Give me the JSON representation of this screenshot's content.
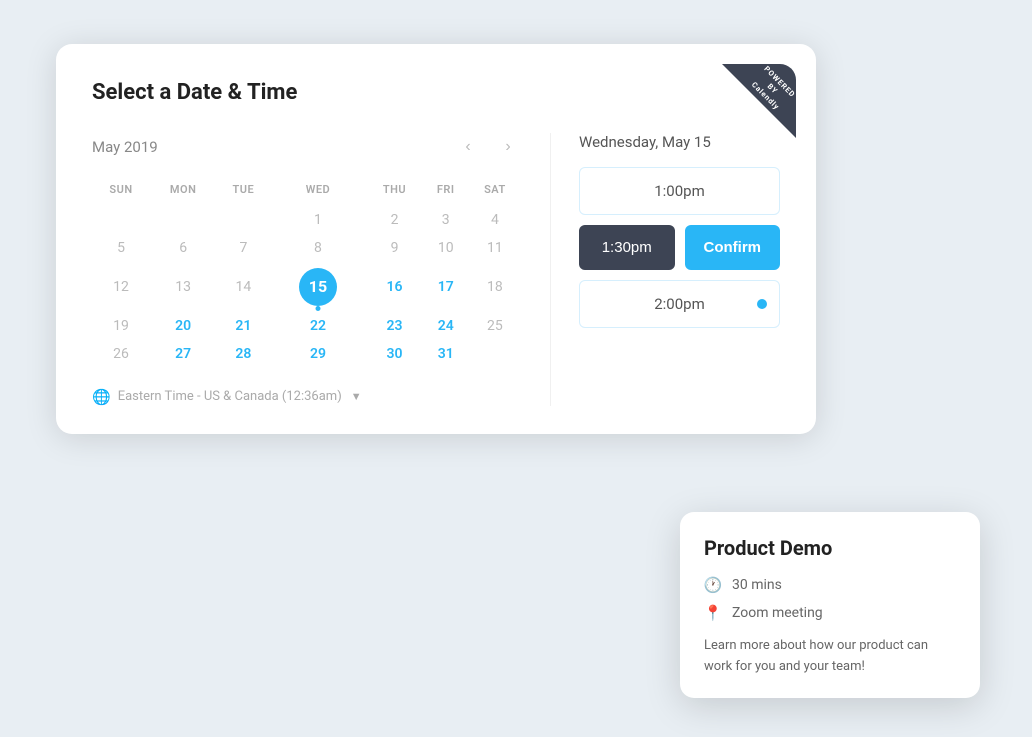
{
  "page": {
    "title": "Select a Date & Time"
  },
  "calendar": {
    "month_year": "May 2019",
    "prev_label": "‹",
    "next_label": "›",
    "day_headers": [
      "SUN",
      "MON",
      "TUE",
      "WED",
      "THU",
      "FRI",
      "SAT"
    ],
    "weeks": [
      [
        null,
        null,
        null,
        "1",
        "2",
        "3",
        "4"
      ],
      [
        "5",
        "6",
        "7",
        "8",
        "9",
        "10",
        "11"
      ],
      [
        "12",
        "13",
        "14",
        "15",
        "16",
        "17",
        "18"
      ],
      [
        "19",
        "20",
        "21",
        "22",
        "23",
        "24",
        "25"
      ],
      [
        "26",
        "27",
        "28",
        "29",
        "30",
        "31",
        null
      ]
    ],
    "selected_day": "15",
    "available_days": [
      "16",
      "17",
      "20",
      "21",
      "22",
      "23",
      "24",
      "27",
      "28",
      "29",
      "30",
      "31"
    ],
    "timezone_label": "Eastern Time - US & Canada (12:36am)"
  },
  "time_panel": {
    "day_label": "Wednesday, May 15",
    "slot_1pm": "1:00pm",
    "slot_1_30pm": "1:30pm",
    "confirm_label": "Confirm",
    "slot_2pm": "2:00pm"
  },
  "product_card": {
    "title": "Product Demo",
    "duration": "30 mins",
    "location": "Zoom meeting",
    "description": "Learn more about how our product can work for you and your team!"
  },
  "badge": {
    "line1": "POWERED",
    "line2": "BY",
    "line3": "Calendly"
  }
}
